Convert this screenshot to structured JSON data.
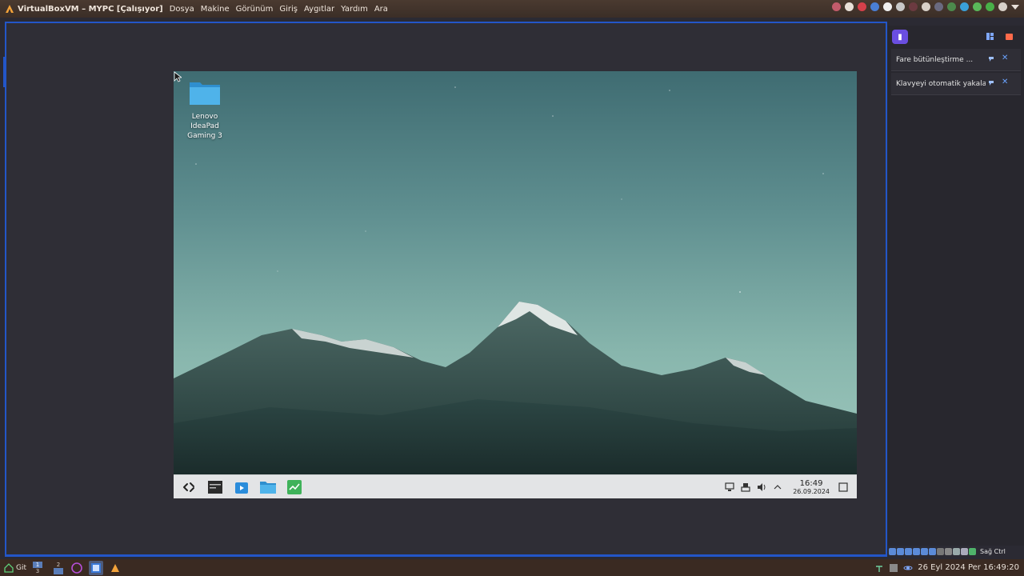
{
  "host_menu": {
    "title": "VirtualBoxVM – MYPC [Çalışıyor]",
    "items": [
      "Dosya",
      "Makine",
      "Görünüm",
      "Giriş",
      "Aygıtlar",
      "Yardım",
      "Ara"
    ]
  },
  "guest": {
    "desktop_icon_label": "Lenovo IdeaPad Gaming 3",
    "clock_time": "16:49",
    "clock_date": "26.09.2024",
    "taskbar_apps": [
      "app-launcher-icon",
      "terminal-icon",
      "software-center-icon",
      "file-manager-icon",
      "system-monitor-icon"
    ],
    "tray_icons": [
      "network-icon",
      "usb-icon",
      "volume-icon",
      "chevron-up-icon",
      "notifications-icon"
    ]
  },
  "notification_panel": {
    "items": [
      {
        "text": "Fare bütünleştirme ..."
      },
      {
        "text": "Klavyeyi otomatik yakala ..."
      }
    ]
  },
  "vm_status": {
    "host_key": "Sağ Ctrl"
  },
  "host_taskbar": {
    "git_label": "Git",
    "pager": [
      "1",
      "2",
      "3"
    ],
    "datetime": "26 Eyl 2024 Per 16:49:20"
  },
  "colors": {
    "accent": "#2356c8",
    "panel_badge": "#6a4ee0",
    "taskbar_guest": "#e3e4e6"
  }
}
